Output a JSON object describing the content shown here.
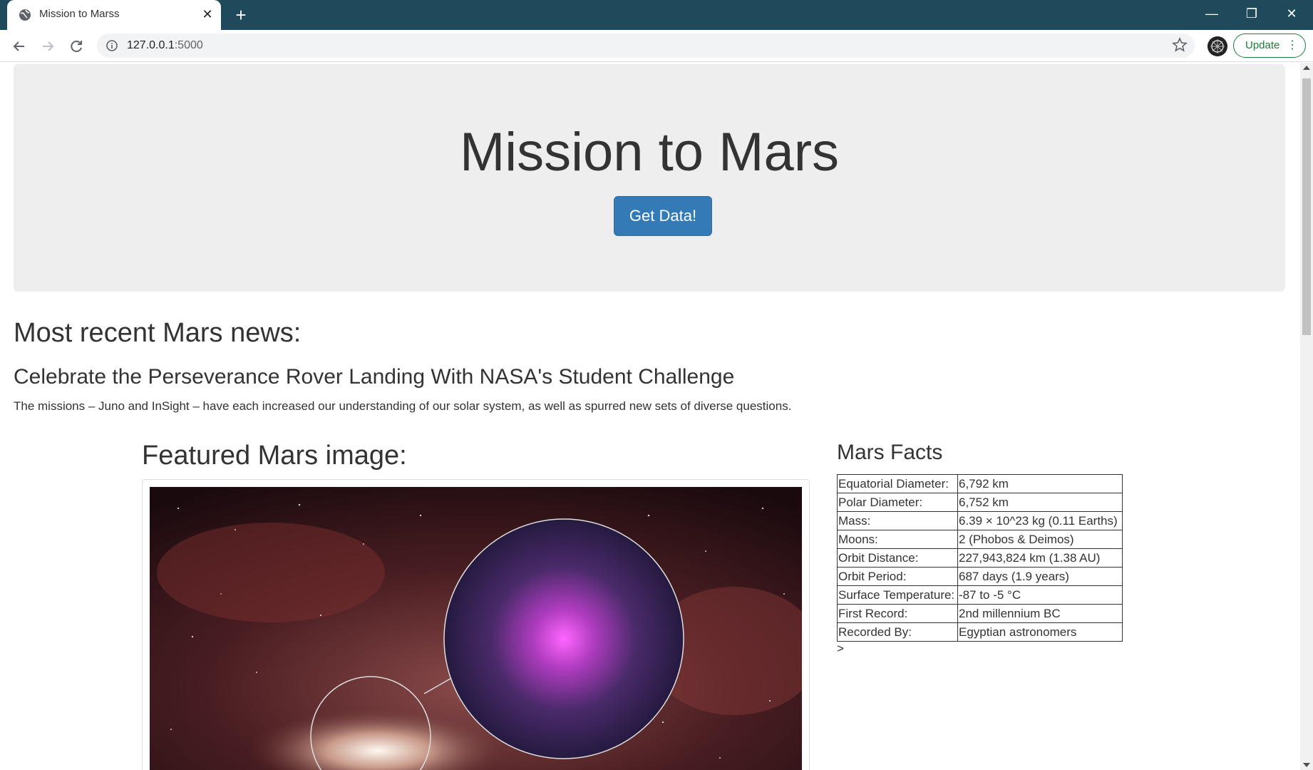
{
  "browser": {
    "tab_title": "Mission to Marss",
    "url_host": "127.0.0.1",
    "url_port": ":5000",
    "update_label": "Update",
    "icons": {
      "favicon": "globe-icon",
      "close": "close-icon",
      "new_tab": "plus-icon",
      "back": "back-arrow-icon",
      "forward": "forward-arrow-icon",
      "reload": "reload-icon",
      "info": "info-icon",
      "bookmark": "star-icon",
      "profile": "profile-avatar-icon",
      "menu": "more-vert-icon"
    },
    "colors": {
      "tabstrip": "#1e4a5c",
      "update_accent": "#188038"
    }
  },
  "page": {
    "jumbotron": {
      "title": "Mission to Mars",
      "button_label": "Get Data!"
    },
    "news": {
      "heading": "Most recent Mars news:",
      "title": "Celebrate the Perseverance Rover Landing With NASA's Student Challenge",
      "paragraph": "The missions – Juno and InSight – have each increased our understanding of our solar system, as well as spurred new sets of diverse questions."
    },
    "featured": {
      "heading": "Featured Mars image:"
    },
    "facts": {
      "heading": "Mars Facts",
      "rows": [
        {
          "label": "Equatorial Diameter:",
          "value": "6,792 km"
        },
        {
          "label": "Polar Diameter:",
          "value": "6,752 km"
        },
        {
          "label": "Mass:",
          "value": "6.39 × 10^23 kg (0.11 Earths)"
        },
        {
          "label": "Moons:",
          "value": "2 (Phobos & Deimos)"
        },
        {
          "label": "Orbit Distance:",
          "value": "227,943,824 km (1.38 AU)"
        },
        {
          "label": "Orbit Period:",
          "value": "687 days (1.9 years)"
        },
        {
          "label": "Surface Temperature:",
          "value": "-87 to -5 °C"
        },
        {
          "label": "First Record:",
          "value": "2nd millennium BC"
        },
        {
          "label": "Recorded By:",
          "value": "Egyptian astronomers"
        }
      ],
      "trailing_text": ">"
    },
    "colors": {
      "button": "#337ab7",
      "jumbotron_bg": "#eeeeee"
    }
  }
}
